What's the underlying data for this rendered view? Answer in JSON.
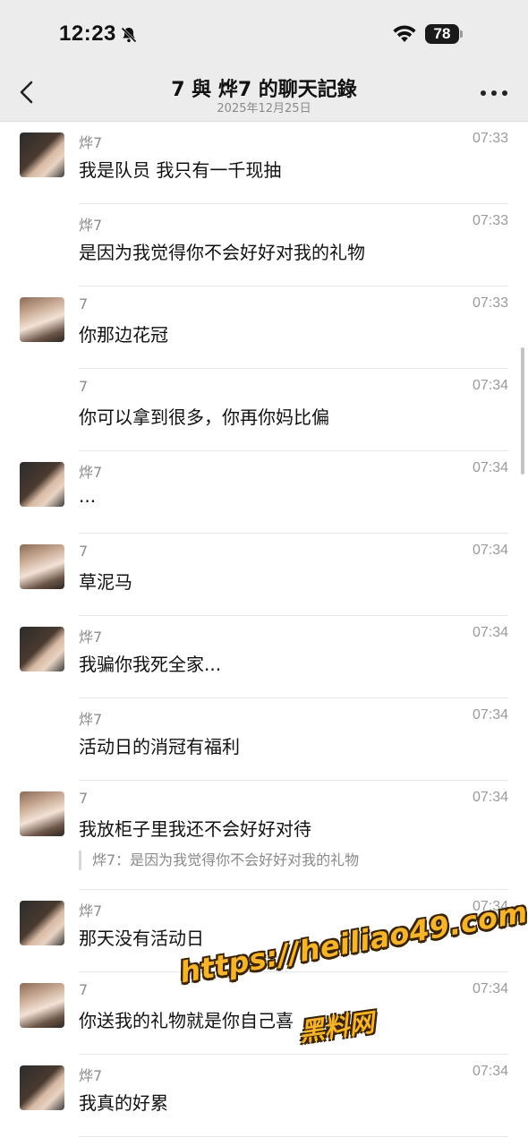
{
  "status_bar": {
    "time": "12:23",
    "battery": "78",
    "icons": [
      "bell-off-icon",
      "wifi-icon",
      "battery-icon"
    ]
  },
  "header": {
    "title": "7 與 烨7 的聊天記錄",
    "subtitle": "2025年12月25日",
    "back_icon": "chevron-left-icon",
    "more_icon": "ellipsis-icon"
  },
  "messages": [
    {
      "sender": "烨7",
      "time": "07:33",
      "text": "我是队员 我只有一千现抽",
      "avatar": "a"
    },
    {
      "sender": "烨7",
      "time": "07:33",
      "text": "是因为我觉得你不会好好对我的礼物",
      "avatar": ""
    },
    {
      "sender": "7",
      "time": "07:33",
      "text": "你那边花冠",
      "avatar": "b"
    },
    {
      "sender": "7",
      "time": "07:34",
      "text": "你可以拿到很多，你再你妈比偏",
      "avatar": ""
    },
    {
      "sender": "烨7",
      "time": "07:34",
      "text": "...",
      "avatar": "a"
    },
    {
      "sender": "7",
      "time": "07:34",
      "text": "草泥马",
      "avatar": "b"
    },
    {
      "sender": "烨7",
      "time": "07:34",
      "text": "我骗你我死全家...",
      "avatar": "a"
    },
    {
      "sender": "烨7",
      "time": "07:34",
      "text": "活动日的消冠有福利",
      "avatar": ""
    },
    {
      "sender": "7",
      "time": "07:34",
      "text": "我放柜子里我还不会好好对待",
      "avatar": "b",
      "quote": "烨7：是因为我觉得你不会好好对我的礼物"
    },
    {
      "sender": "烨7",
      "time": "07:34",
      "text": "那天没有活动日",
      "avatar": "a"
    },
    {
      "sender": "7",
      "time": "07:34",
      "text": "你送我的礼物就是你自己喜",
      "avatar": "b"
    },
    {
      "sender": "烨7",
      "time": "07:34",
      "text": "我真的好累",
      "avatar": "a"
    }
  ],
  "watermark": {
    "url": "https://heiliao49.com",
    "name": "黑料网"
  },
  "colors": {
    "background": "#ffffff",
    "bar": "#ececec",
    "watermark": "#f6b42a"
  }
}
